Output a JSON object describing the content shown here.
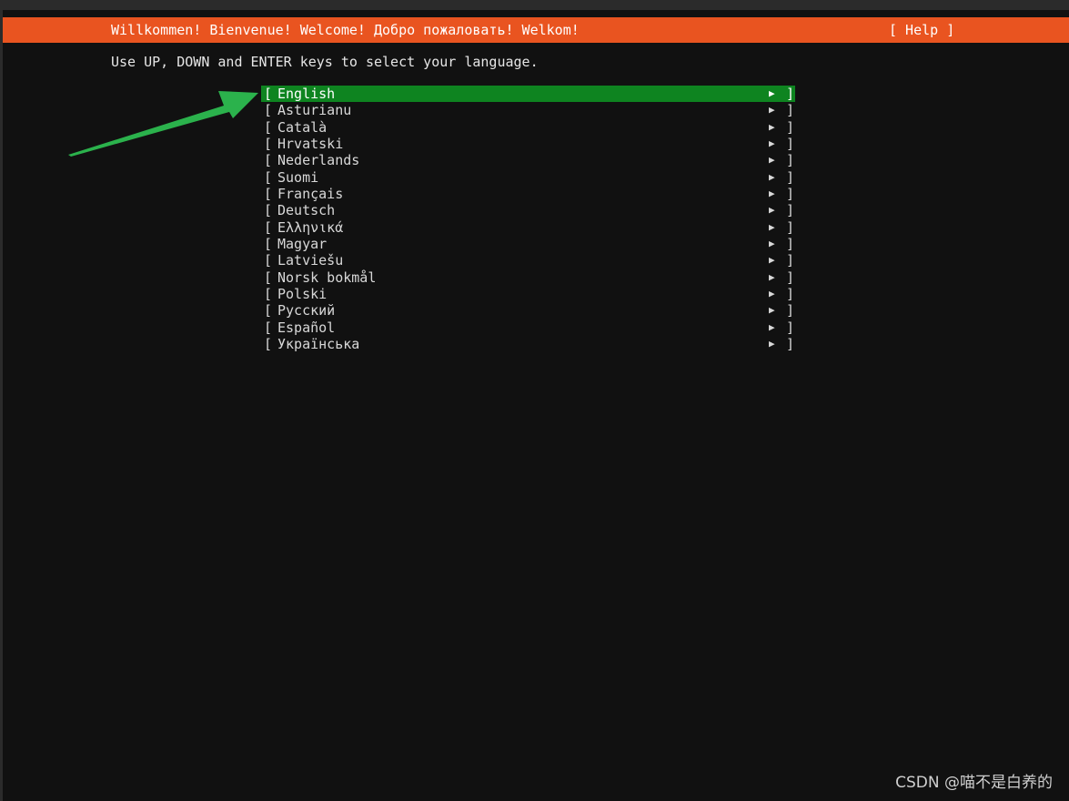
{
  "header": {
    "title": "Willkommen! Bienvenue! Welcome! Добро пожаловать! Welkom!",
    "help_label": "[ Help ]",
    "bg_color": "#e95420"
  },
  "instructions": "Use UP, DOWN and ENTER keys to select your language.",
  "languages": {
    "left_bracket": "[",
    "right_bracket": "]",
    "arrow_glyph": "▶",
    "selected_index": 0,
    "selected_color": "#0e8420",
    "items": [
      {
        "label": "English"
      },
      {
        "label": "Asturianu"
      },
      {
        "label": "Català"
      },
      {
        "label": "Hrvatski"
      },
      {
        "label": "Nederlands"
      },
      {
        "label": "Suomi"
      },
      {
        "label": "Français"
      },
      {
        "label": "Deutsch"
      },
      {
        "label": "Ελληνικά"
      },
      {
        "label": "Magyar"
      },
      {
        "label": "Latviešu"
      },
      {
        "label": "Norsk bokmål"
      },
      {
        "label": "Polski"
      },
      {
        "label": "Русский"
      },
      {
        "label": "Español"
      },
      {
        "label": "Українська"
      }
    ]
  },
  "annotation": {
    "arrow_color": "#2bb24c"
  },
  "watermark": "CSDN @喵不是白养的"
}
